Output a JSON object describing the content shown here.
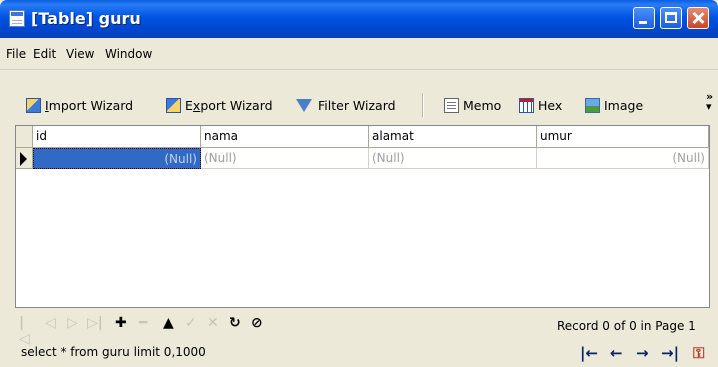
{
  "window": {
    "title": "[Table] guru"
  },
  "menu": [
    "File",
    "Edit",
    "View",
    "Window"
  ],
  "toolbar": {
    "import_prefix": "",
    "import_accel": "I",
    "import_rest": "mport Wizard",
    "export_prefix": "E",
    "export_accel": "x",
    "export_rest": "port Wizard",
    "filter_label": "Filter Wizard",
    "memo_label": "Memo",
    "hex_label": "Hex",
    "image_label": "Image",
    "overflow": "»"
  },
  "grid": {
    "columns": [
      "id",
      "nama",
      "alamat",
      "umur"
    ],
    "rows": [
      [
        "(Null)",
        "(Null)",
        "(Null)",
        "(Null)"
      ]
    ]
  },
  "navigator": {
    "buttons": [
      "first-icon",
      "prior-icon",
      "next-icon",
      "last-icon",
      "insert-icon",
      "delete-icon",
      "edit-icon",
      "post-icon",
      "cancel-icon",
      "refresh-icon",
      "stop-icon"
    ]
  },
  "status": {
    "record": "Record 0 of 0 in Page 1",
    "sql": "select * from guru limit 0,1000"
  }
}
